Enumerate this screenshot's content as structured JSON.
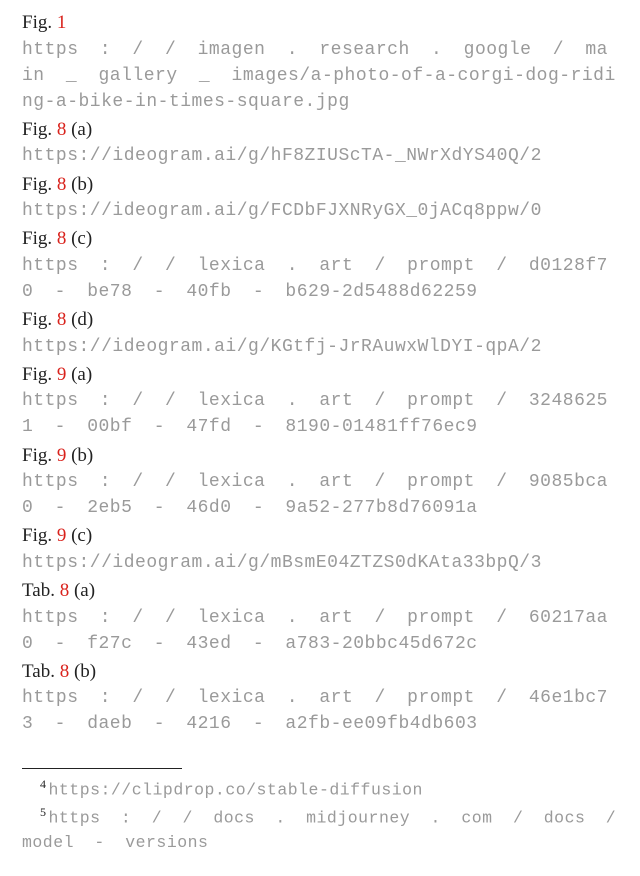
{
  "entries": [
    {
      "label": "Fig. ",
      "num": "1",
      "suffix": "",
      "url": "https : / / imagen . research . google / main _ gallery _ images/a-photo-of-a-corgi-dog-riding-a-bike-in-times-square.jpg",
      "wide": true
    },
    {
      "label": "Fig. ",
      "num": "8",
      "suffix": " (a)",
      "url": "https://ideogram.ai/g/hF8ZIUScTA-_NWrXdYS40Q/2",
      "wide": false
    },
    {
      "label": "Fig. ",
      "num": "8",
      "suffix": " (b)",
      "url": "https://ideogram.ai/g/FCDbFJXNRyGX_0jACq8ppw/0",
      "wide": false
    },
    {
      "label": "Fig. ",
      "num": "8",
      "suffix": " (c)",
      "url": "https : / / lexica . art / prompt / d0128f70 - be78 - 40fb - b629-2d5488d62259",
      "wide": true
    },
    {
      "label": "Fig. ",
      "num": "8",
      "suffix": " (d)",
      "url": "https://ideogram.ai/g/KGtfj-JrRAuwxWlDYI-qpA/2",
      "wide": false
    },
    {
      "label": "Fig. ",
      "num": "9",
      "suffix": " (a)",
      "url": "https : / / lexica . art / prompt / 32486251 - 00bf - 47fd - 8190-01481ff76ec9",
      "wide": true
    },
    {
      "label": "Fig. ",
      "num": "9",
      "suffix": " (b)",
      "url": "https : / / lexica . art / prompt / 9085bca0 - 2eb5 - 46d0 - 9a52-277b8d76091a",
      "wide": true
    },
    {
      "label": "Fig. ",
      "num": "9",
      "suffix": " (c)",
      "url": "https://ideogram.ai/g/mBsmE04ZTZS0dKAta33bpQ/3",
      "wide": false
    },
    {
      "label": "Tab. ",
      "num": "8",
      "suffix": " (a)",
      "url": "https : / / lexica . art / prompt / 60217aa0 - f27c - 43ed - a783-20bbc45d672c",
      "wide": true
    },
    {
      "label": "Tab. ",
      "num": "8",
      "suffix": " (b)",
      "url": "https : / / lexica . art / prompt / 46e1bc73 - daeb - 4216 - a2fb-ee09fb4db603",
      "wide": true
    }
  ],
  "footnotes": [
    {
      "marker": "4",
      "url": "https://clipdrop.co/stable-diffusion",
      "wide": false
    },
    {
      "marker": "5",
      "url": "https : / / docs . midjourney . com / docs / model - versions",
      "wide": true
    }
  ]
}
